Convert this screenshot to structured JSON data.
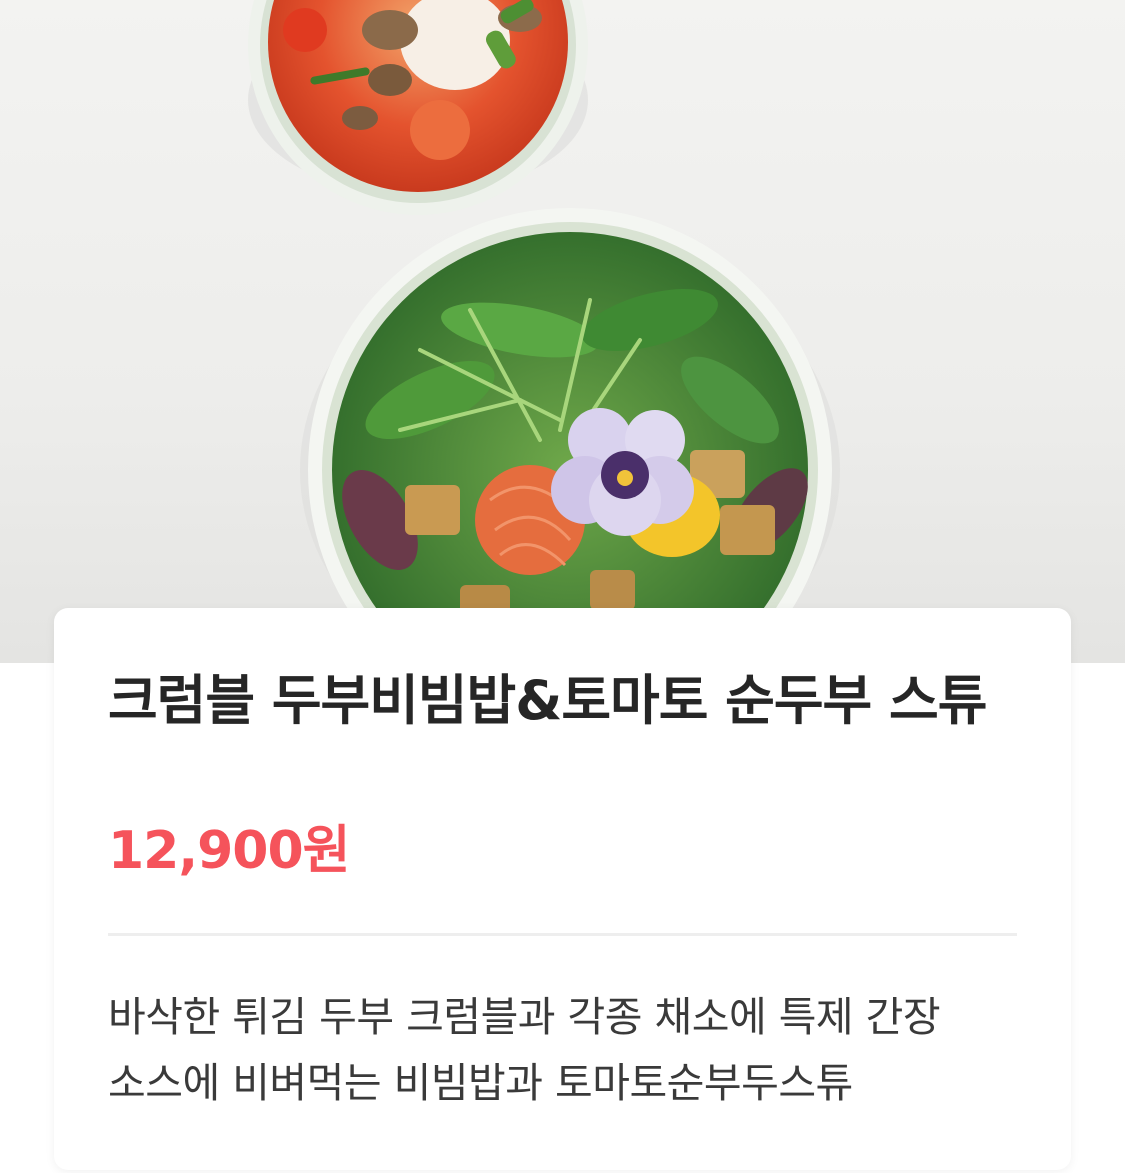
{
  "product": {
    "title": "크럼블 두부비빔밥&토마토 순두부 스튜",
    "price": "12,900원",
    "description_lines": [
      "바삭한 튀김 두부 크럼블과 각종 채소에 특제 간장",
      "소스에 비벼먹는 비빔밥과 토마토순부두스튜"
    ]
  },
  "colors": {
    "price": "#f5535b",
    "title": "#262626",
    "background": "#ffffff"
  },
  "hero_image": {
    "content": "food-photo"
  }
}
